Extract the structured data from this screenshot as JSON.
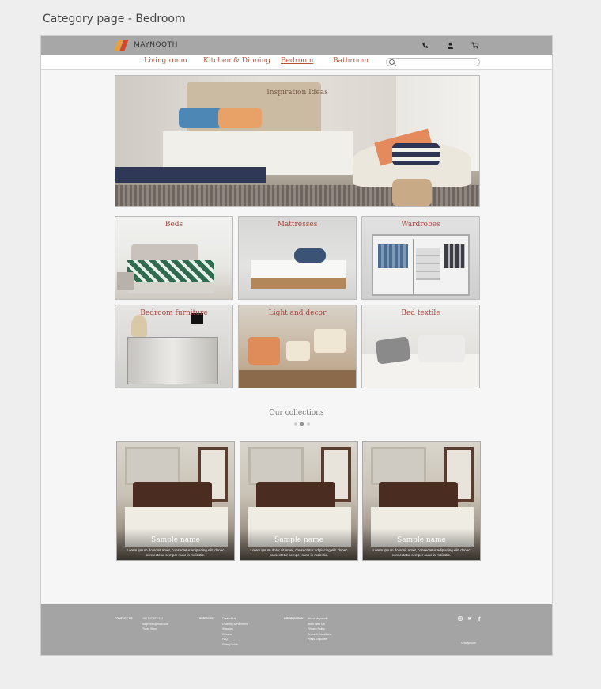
{
  "page": {
    "title": "Category page - Bedroom"
  },
  "header": {
    "logo_text": "MAYNOOTH",
    "icons": [
      "phone-icon",
      "user-icon",
      "cart-icon"
    ]
  },
  "nav": {
    "items": [
      {
        "label": "Living room",
        "active": false
      },
      {
        "label": "Kitchen & Dinning",
        "active": false
      },
      {
        "label": "Bedroom",
        "active": true
      },
      {
        "label": "Bathroom",
        "active": false
      }
    ],
    "search_placeholder": ""
  },
  "hero": {
    "caption": "Inspiration Ideas"
  },
  "categories": [
    {
      "label": "Beds"
    },
    {
      "label": "Mattresses"
    },
    {
      "label": "Wardrobes"
    },
    {
      "label": "Bedroom furniture"
    },
    {
      "label": "Light and decor"
    },
    {
      "label": "Bed textile"
    }
  ],
  "collections": {
    "title": "Our collections",
    "pagination": {
      "count": 3,
      "active": 1
    },
    "cards": [
      {
        "name": "Sample name",
        "description": "Lorem ipsum dolor sit amet, consectetur adipiscing elit. donec consectetur semper nunc in molestie."
      },
      {
        "name": "Sample name",
        "description": "Lorem ipsum dolor sit amet, consectetur adipiscing elit. donec consectetur semper nunc in molestie."
      },
      {
        "name": "Sample name",
        "description": "Lorem ipsum dolor sit amet, consectetur adipiscing elit. donec consectetur semper nunc in molestie."
      }
    ]
  },
  "footer": {
    "contact": {
      "heading": "CONTACT US",
      "lines": [
        "+01 547 879 431",
        "maynooth@mail.com",
        "Trade Store"
      ]
    },
    "services": {
      "heading": "SERVICES",
      "lines": [
        "Contact Us",
        "Ordering & Payment",
        "Shipping",
        "Returns",
        "FAQ",
        "Sizing Guide"
      ]
    },
    "information": {
      "heading": "INFORMATION",
      "lines": [
        "About Maynooth",
        "Work With US",
        "Privacy Policy",
        "Terms & Conditions",
        "Press Enquiries"
      ]
    },
    "social_icons": [
      "instagram-icon",
      "twitter-icon",
      "facebook-icon"
    ],
    "copyright": "© Maynooth"
  },
  "colors": {
    "nav_text": "#b6543a",
    "category_caption": "#a4463d",
    "topbar": "#a7a7a7",
    "footer": "#a4a4a4"
  }
}
